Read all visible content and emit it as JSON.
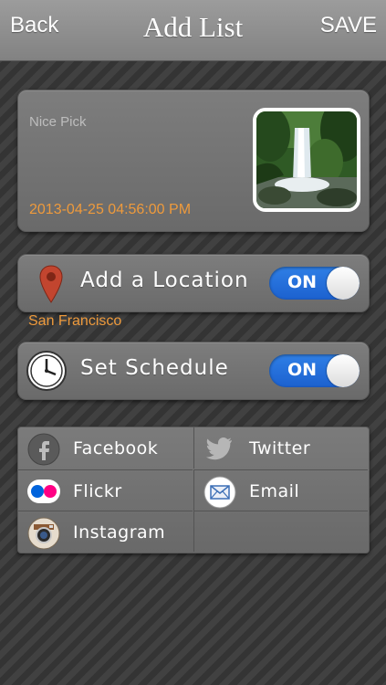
{
  "navbar": {
    "back_label": "Back",
    "title": "Add List",
    "save_label": "SAVE"
  },
  "pick": {
    "name": "Nice Pick",
    "datetime": "2013-04-25 04:56:00 PM"
  },
  "location": {
    "label": "Add a Location",
    "toggle_state": "ON",
    "value": "San Francisco",
    "icon": "map-pin-icon"
  },
  "schedule": {
    "label": "Set Schedule",
    "toggle_state": "ON",
    "icon": "clock-icon"
  },
  "share": {
    "items": [
      {
        "label": "Facebook",
        "icon": "facebook-icon"
      },
      {
        "label": "Twitter",
        "icon": "twitter-icon"
      },
      {
        "label": "Flickr",
        "icon": "flickr-icon"
      },
      {
        "label": "Email",
        "icon": "email-icon"
      },
      {
        "label": "Instagram",
        "icon": "instagram-icon"
      }
    ]
  },
  "colors": {
    "accent_orange": "#ee9a3c",
    "toggle_blue": "#2f7fe6",
    "navbar_gray": "#8f8f8f"
  }
}
